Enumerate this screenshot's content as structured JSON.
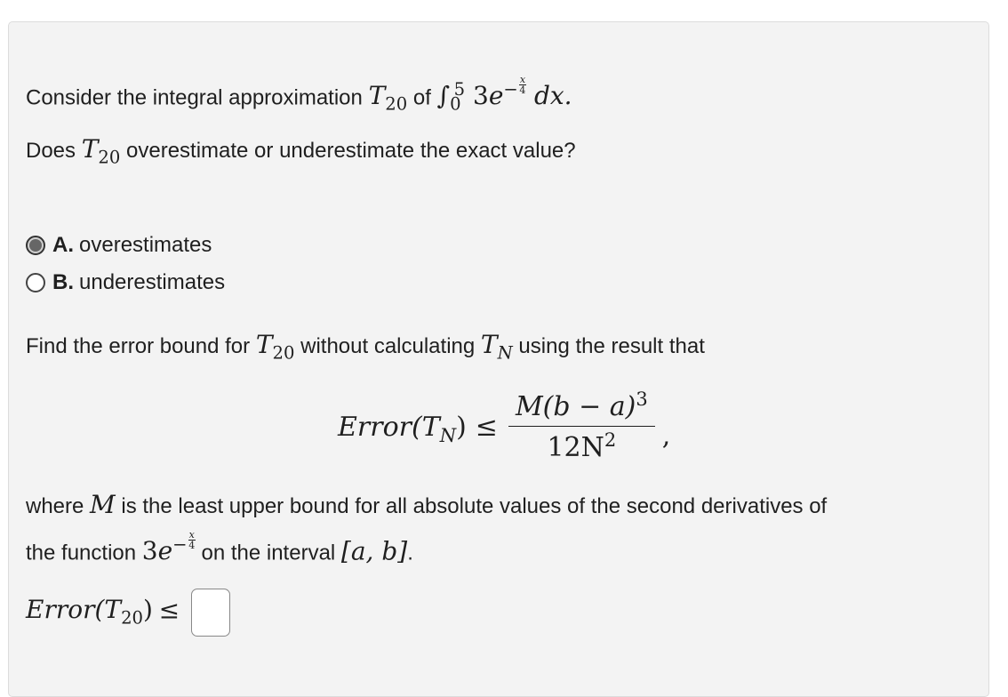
{
  "question": {
    "intro_prefix": "Consider the integral approximation",
    "intro_of": "of",
    "T": "T",
    "n20": "20",
    "int_lower": "0",
    "int_upper": "5",
    "coef": "3",
    "e": "e",
    "exp_minus": "−",
    "exp_num": "x",
    "exp_den": "4",
    "dx": "dx.",
    "ask_prefix": "Does",
    "ask_suffix": "overestimate or underestimate the exact value?"
  },
  "choices": [
    {
      "letter": "A.",
      "text": "overestimates",
      "selected": true
    },
    {
      "letter": "B.",
      "text": "underestimates",
      "selected": false
    }
  ],
  "error_prompt": {
    "prefix": "Find the error bound for",
    "middle": "without calculating",
    "suffix": "using the result that",
    "TN": "T",
    "N": "N"
  },
  "formula": {
    "lhs": "Error(T",
    "N": "N",
    "rhs_close": ")",
    "leq": "≤",
    "numerator": "M(b − a)",
    "num_exp": "3",
    "denominator": "12N",
    "den_exp": "2",
    "comma": ","
  },
  "where_text": {
    "w1": "where",
    "M": "M",
    "w2": "is the least upper bound for all absolute values of the second derivatives of",
    "w3": "the function",
    "w4": "on the interval",
    "interval": "[a, b]",
    "period": "."
  },
  "answer": {
    "lhs": "Error(T",
    "sub": "20",
    "close": ")",
    "leq": "≤"
  }
}
